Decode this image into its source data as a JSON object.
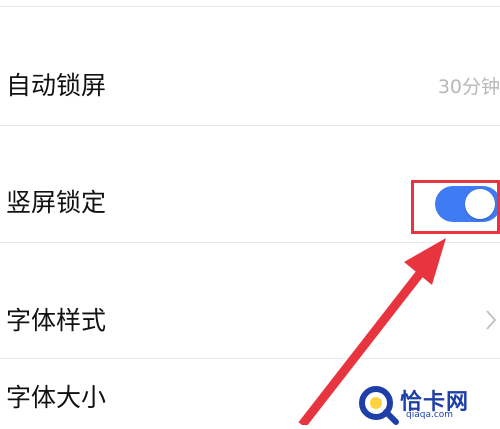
{
  "settings": {
    "rows": [
      {
        "label": "自动锁屏",
        "value": "30分钟"
      },
      {
        "label": "竖屏锁定",
        "toggle_on": true
      },
      {
        "label": "字体样式"
      },
      {
        "label": "字体大小"
      }
    ]
  },
  "colors": {
    "toggle_accent": "#3f7bf3",
    "annotation_red": "#e8343f",
    "watermark_blue": "#1f3fa8"
  },
  "icons": {
    "chevron": "chevron-right-icon",
    "arrow": "red-arrow-annotation"
  },
  "watermark": {
    "title": "恰卡网",
    "domain": "qiaqa.com"
  }
}
